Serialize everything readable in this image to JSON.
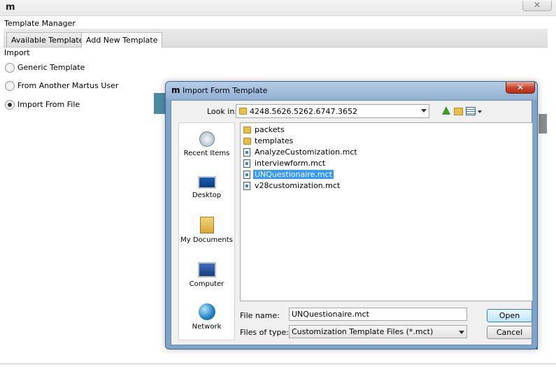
{
  "app": {
    "logo_text": "m",
    "close_glyph": "✕"
  },
  "template_manager": {
    "title": "Template Manager",
    "tabs": [
      {
        "label": "Available Templates"
      },
      {
        "label": "Add New Template"
      }
    ],
    "import_label": "Import",
    "import_options": [
      {
        "label": "Generic Template",
        "selected": false
      },
      {
        "label": "From Another Martus User",
        "selected": false
      },
      {
        "label": "Import From File",
        "selected": true
      }
    ]
  },
  "dialog": {
    "logo_text": "m",
    "title": "Import Form Template",
    "close_glyph": "✕",
    "look_in_label": "Look in:",
    "look_in_value": "4248.5626.5262.6747.3652",
    "toolbar_icons": [
      "up-folder-icon",
      "new-folder-icon",
      "view-menu-icon"
    ],
    "places": [
      {
        "label": "Recent Items",
        "icon": "recent-items-icon"
      },
      {
        "label": "Desktop",
        "icon": "desktop-icon"
      },
      {
        "label": "My Documents",
        "icon": "my-documents-icon"
      },
      {
        "label": "Computer",
        "icon": "computer-icon"
      },
      {
        "label": "Network",
        "icon": "network-icon"
      }
    ],
    "files": [
      {
        "name": "packets",
        "type": "folder",
        "selected": false
      },
      {
        "name": "templates",
        "type": "folder",
        "selected": false
      },
      {
        "name": "AnalyzeCustomization.mct",
        "type": "file",
        "selected": false
      },
      {
        "name": "interviewform.mct",
        "type": "file",
        "selected": false
      },
      {
        "name": "UNQuestionaire.mct",
        "type": "file",
        "selected": true
      },
      {
        "name": "v28customization.mct",
        "type": "file",
        "selected": false
      }
    ],
    "file_name_label": "File name:",
    "file_name_value": "UNQuestionaire.mct",
    "files_of_type_label": "Files of type:",
    "files_of_type_value": "Customization Template Files (*.mct)",
    "open_label": "Open",
    "cancel_label": "Cancel"
  },
  "colors": {
    "selection": "#3399ff",
    "dialog_frame": "#7fa4c9",
    "close_button": "#c7432b"
  }
}
